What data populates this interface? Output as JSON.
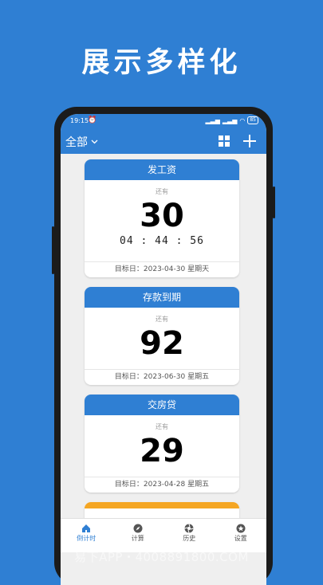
{
  "headline": "展示多样化",
  "status_bar": {
    "time": "19:15",
    "battery": "85"
  },
  "app_bar": {
    "filter_label": "全部"
  },
  "cards": [
    {
      "title": "发工资",
      "remaining_label": "还有",
      "days": "30",
      "countdown": "04 : 44 : 56",
      "target": "目标日：2023-04-30 星期天"
    },
    {
      "title": "存款到期",
      "remaining_label": "还有",
      "days": "92",
      "target": "目标日：2023-06-30 星期五"
    },
    {
      "title": "交房贷",
      "remaining_label": "还有",
      "days": "29",
      "target": "目标日：2023-04-28 星期五"
    }
  ],
  "bottom_nav": [
    {
      "label": "倒计时",
      "icon": "home-icon"
    },
    {
      "label": "计算",
      "icon": "compass-icon"
    },
    {
      "label": "历史",
      "icon": "aperture-icon"
    },
    {
      "label": "设置",
      "icon": "star-icon"
    }
  ],
  "watermark": "易下APP・4008891800.COM",
  "colors": {
    "primary": "#2f7fd3",
    "accent_orange": "#f5a623",
    "background": "#efefef"
  }
}
